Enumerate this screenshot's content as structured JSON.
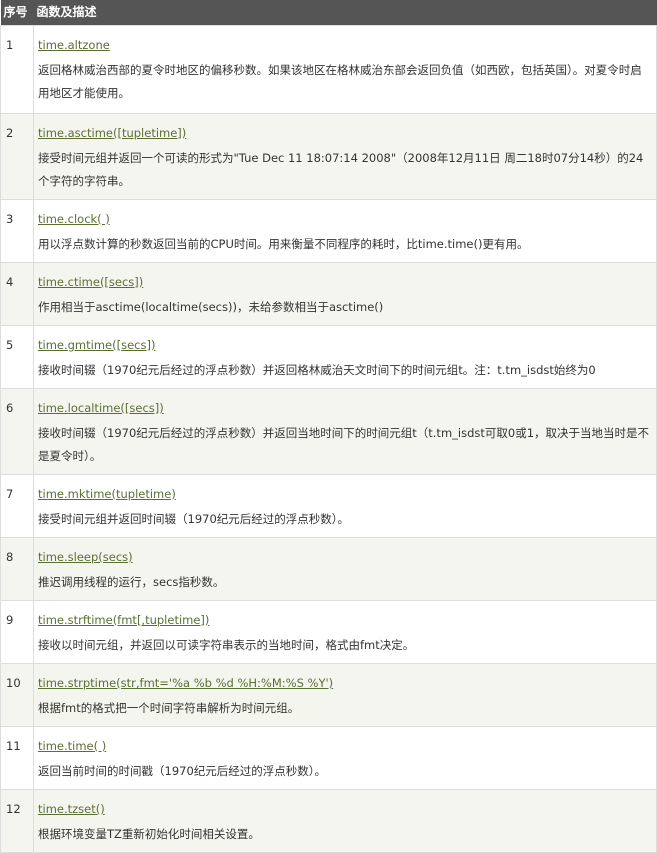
{
  "header": {
    "num": "序号",
    "desc": "函数及描述"
  },
  "rows": [
    {
      "num": "1",
      "func": "time.altzone",
      "desc": "返回格林威治西部的夏令时地区的偏移秒数。如果该地区在格林威治东部会返回负值（如西欧，包括英国）。对夏令时启用地区才能使用。"
    },
    {
      "num": "2",
      "func": "time.asctime([tupletime])",
      "desc": "接受时间元组并返回一个可读的形式为\"Tue Dec 11 18:07:14 2008\"（2008年12月11日 周二18时07分14秒）的24个字符的字符串。"
    },
    {
      "num": "3",
      "func": "time.clock( )",
      "desc": "用以浮点数计算的秒数返回当前的CPU时间。用来衡量不同程序的耗时，比time.time()更有用。"
    },
    {
      "num": "4",
      "func": "time.ctime([secs])",
      "desc": "作用相当于asctime(localtime(secs))，未给参数相当于asctime()"
    },
    {
      "num": "5",
      "func": "time.gmtime([secs])",
      "desc": "接收时间辍（1970纪元后经过的浮点秒数）并返回格林威治天文时间下的时间元组t。注：t.tm_isdst始终为0"
    },
    {
      "num": "6",
      "func": "time.localtime([secs])",
      "desc": "接收时间辍（1970纪元后经过的浮点秒数）并返回当地时间下的时间元组t（t.tm_isdst可取0或1，取决于当地当时是不是夏令时）。"
    },
    {
      "num": "7",
      "func": "time.mktime(tupletime)",
      "desc": "接受时间元组并返回时间辍（1970纪元后经过的浮点秒数）。"
    },
    {
      "num": "8",
      "func": "time.sleep(secs)",
      "desc": "推迟调用线程的运行，secs指秒数。"
    },
    {
      "num": "9",
      "func": "time.strftime(fmt[,tupletime])",
      "desc": "接收以时间元组，并返回以可读字符串表示的当地时间，格式由fmt决定。"
    },
    {
      "num": "10",
      "func": "time.strptime(str,fmt='%a %b %d %H:%M:%S %Y')",
      "desc": "根据fmt的格式把一个时间字符串解析为时间元组。"
    },
    {
      "num": "11",
      "func": "time.time( )",
      "desc": "返回当前时间的时间戳（1970纪元后经过的浮点秒数）。"
    },
    {
      "num": "12",
      "func": "time.tzset()",
      "desc": "根据环境变量TZ重新初始化时间相关设置。"
    }
  ]
}
